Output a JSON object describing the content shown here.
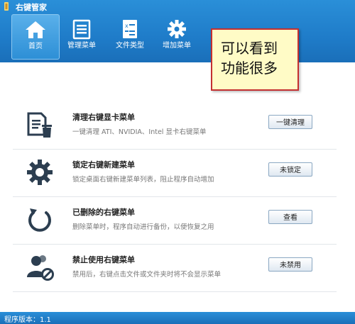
{
  "window": {
    "title": "右键管家"
  },
  "toolbar": {
    "items": [
      {
        "label": "首页",
        "icon": "home-icon",
        "active": true
      },
      {
        "label": "管理菜单",
        "icon": "menu-list-icon",
        "active": false
      },
      {
        "label": "文件类型",
        "icon": "file-type-icon",
        "active": false
      },
      {
        "label": "增加菜单",
        "icon": "gear-icon",
        "active": false
      }
    ]
  },
  "features": [
    {
      "title": "清理右键显卡菜单",
      "description": "一键清理 ATI、NVIDIA、Intel 显卡右键菜单",
      "button": "一键清理",
      "icon": "document-trash-icon"
    },
    {
      "title": "锁定右键新建菜单",
      "description": "锁定桌面右键新建菜单列表，阻止程序自动增加",
      "button": "未锁定",
      "icon": "gear-icon"
    },
    {
      "title": "已删除的右键菜单",
      "description": "删除菜单时，程序自动进行备份，以便恢复之用",
      "button": "查看",
      "icon": "restore-arrow-icon"
    },
    {
      "title": "禁止使用右键菜单",
      "description": "禁用后，右键点击文件或文件夹时将不会显示菜单",
      "button": "未禁用",
      "icon": "users-blocked-icon"
    }
  ],
  "statusbar": {
    "text": "程序版本：1.1"
  },
  "annotation": {
    "lines": [
      "可以看到",
      "功能很多"
    ]
  },
  "colors": {
    "header_blue": "#1f7cc9",
    "icon_dark": "#2c3e50",
    "callout_bg": "#fffbc6",
    "callout_border": "#c43030"
  }
}
